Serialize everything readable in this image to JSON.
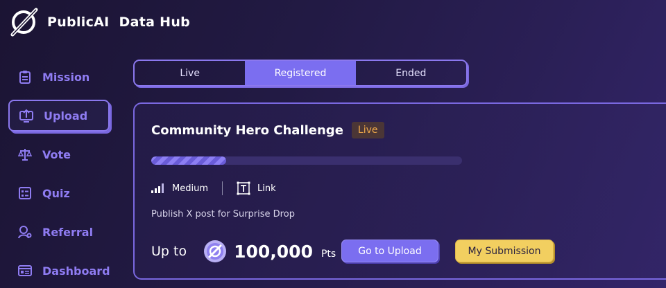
{
  "app": {
    "brand": "PublicAI",
    "product": "Data Hub"
  },
  "sidebar": {
    "items": [
      {
        "label": "Mission",
        "icon": "clipboard-icon"
      },
      {
        "label": "Upload",
        "icon": "upload-icon",
        "active": true
      },
      {
        "label": "Vote",
        "icon": "scale-icon"
      },
      {
        "label": "Quiz",
        "icon": "quiz-icon"
      },
      {
        "label": "Referral",
        "icon": "referral-icon"
      },
      {
        "label": "Dashboard",
        "icon": "dashboard-icon"
      }
    ]
  },
  "tabs": [
    {
      "label": "Live"
    },
    {
      "label": "Registered",
      "active": true
    },
    {
      "label": "Ended"
    }
  ],
  "challenge": {
    "title": "Community Hero Challenge",
    "status": "Live",
    "progress": 0.24,
    "difficulty": "Medium",
    "type": "Link",
    "description": "Publish X post for Surprise Drop",
    "reward_prefix": "Up to",
    "reward_amount": "100,000",
    "reward_unit": "Pts",
    "primary_button": "Go to Upload",
    "secondary_button": "My Submission"
  },
  "colors": {
    "accent": "#7b6ef0",
    "nav_text": "#8f7cf2",
    "status_live": "#f0a94a",
    "submission_button": "#f2cf60"
  }
}
